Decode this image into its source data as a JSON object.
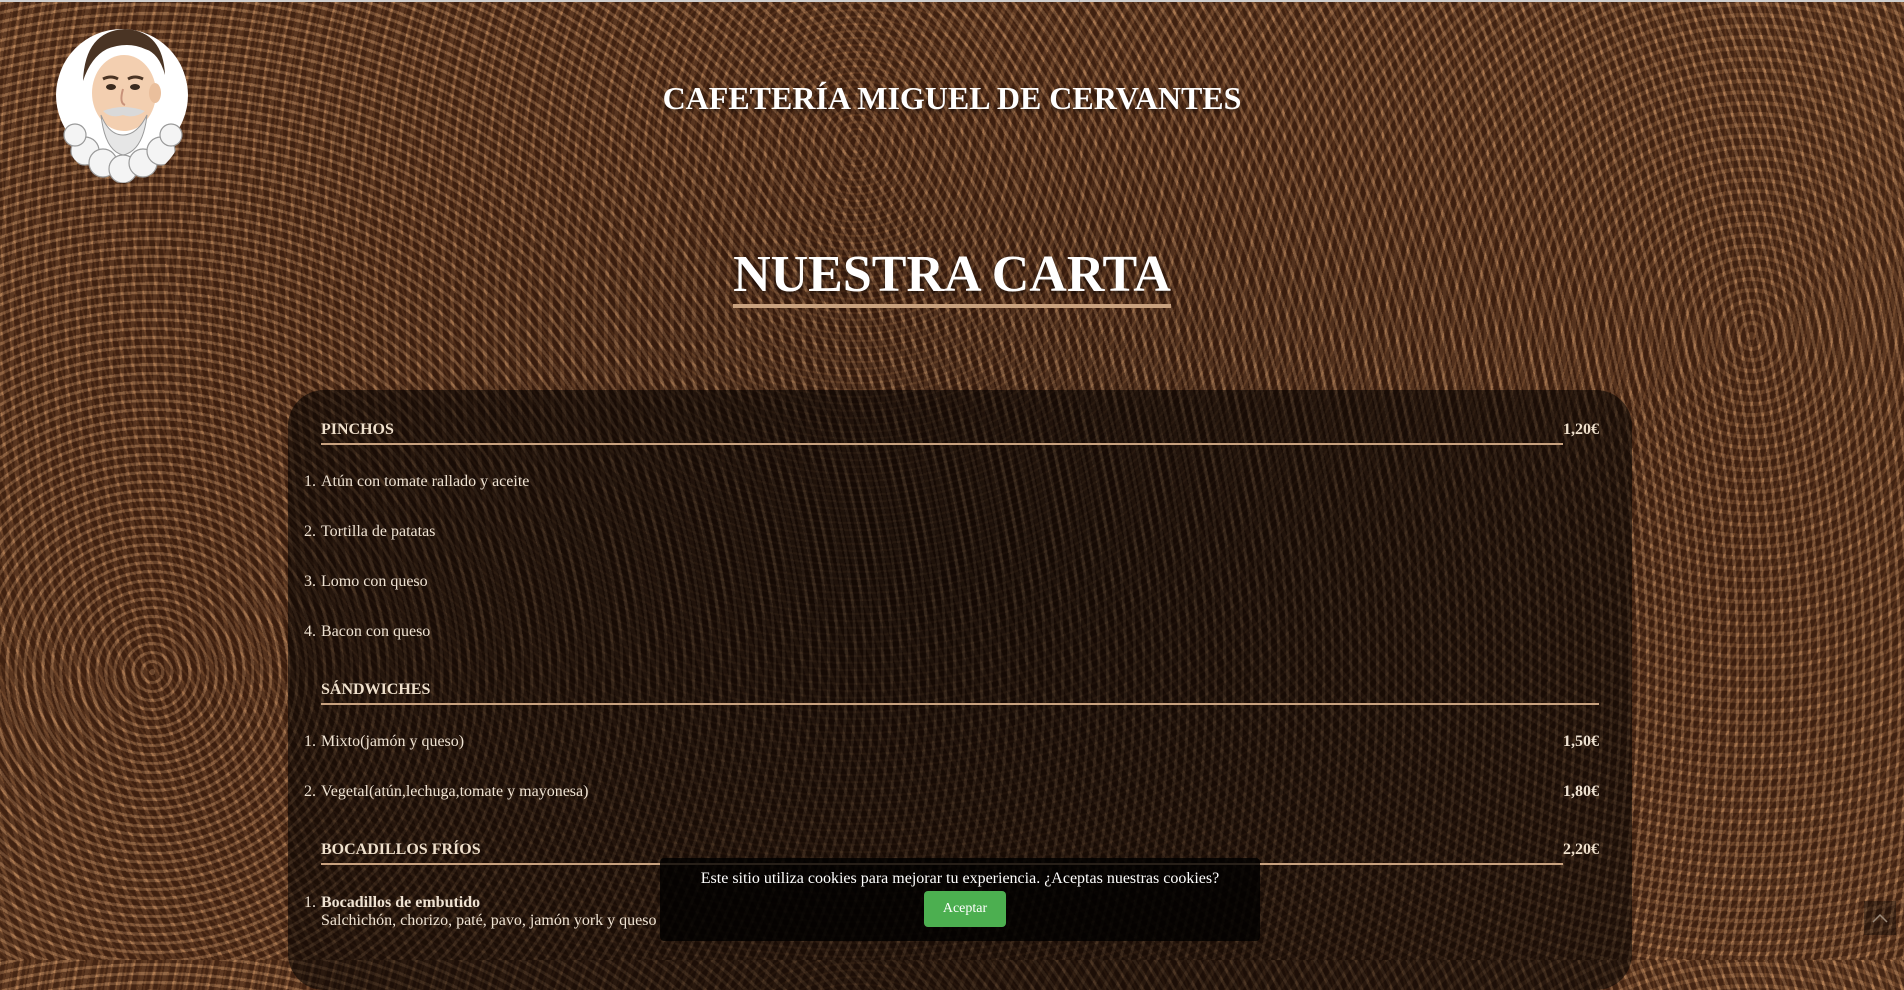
{
  "site": {
    "title": "CAFETERÍA MIGUEL DE CERVANTES"
  },
  "menu": {
    "heading": "NUESTRA CARTA",
    "sections": [
      {
        "name": "PINCHOS",
        "price": "1,20€",
        "items": [
          {
            "num": "1.",
            "label": "Atún con tomate rallado y aceite"
          },
          {
            "num": "2.",
            "label": "Tortilla de patatas"
          },
          {
            "num": "3.",
            "label": "Lomo con queso"
          },
          {
            "num": "4.",
            "label": "Bacon con queso"
          }
        ]
      },
      {
        "name": "SÁNDWICHES",
        "items": [
          {
            "num": "1.",
            "label": "Mixto(jamón y queso)",
            "price": "1,50€"
          },
          {
            "num": "2.",
            "label": "Vegetal(atún,lechuga,tomate y mayonesa)",
            "price": "1,80€"
          }
        ]
      },
      {
        "name": "BOCADILLOS FRÍOS",
        "price": "2,20€",
        "items": [
          {
            "num": "1.",
            "label": "Bocadillos de embutido",
            "description": "Salchichón, chorizo, paté, pavo, jamón york y queso"
          }
        ]
      }
    ]
  },
  "cookie_banner": {
    "text": "Este sitio utiliza cookies para mejorar tu experiencia. ¿Aceptas nuestras cookies?",
    "accept_label": "Aceptar"
  },
  "icons": {
    "logo": "cervantes-portrait-icon",
    "scroll_top": "chevron-up-icon"
  },
  "colors": {
    "accent_line": "#c9a27f",
    "accept_button": "#4caf50"
  }
}
